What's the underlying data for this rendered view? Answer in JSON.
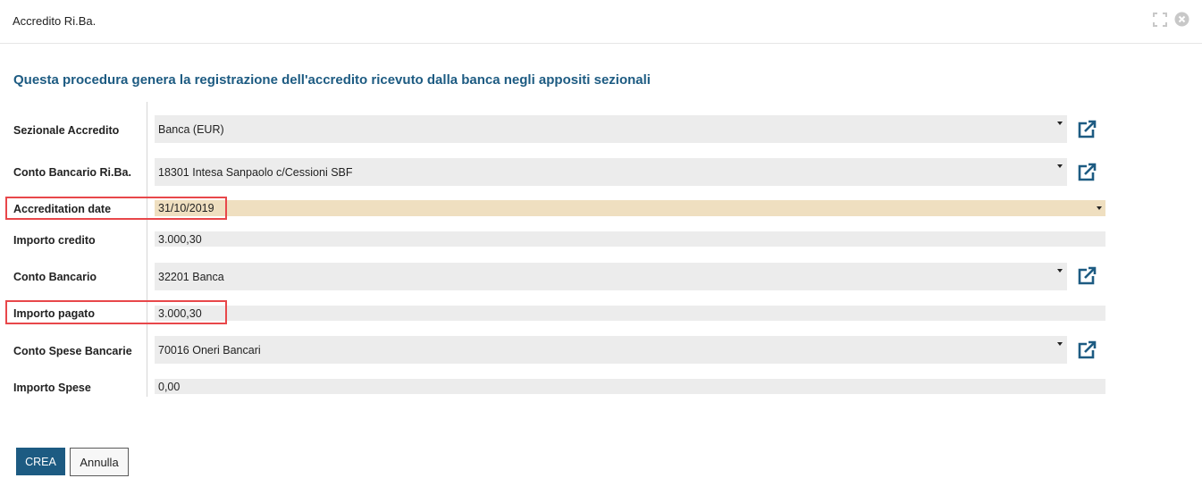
{
  "window": {
    "title": "Accredito Ri.Ba.",
    "icons": [
      "expand-icon",
      "close-icon"
    ]
  },
  "heading": "Questa procedura genera la registrazione dell'accredito ricevuto dalla banca negli appositi sezionali",
  "fields": {
    "sezionale_accredito": {
      "label": "Sezionale Accredito",
      "value": "Banca (EUR)"
    },
    "conto_bancario_riba": {
      "label": "Conto Bancario Ri.Ba.",
      "value": "18301 Intesa Sanpaolo c/Cessioni SBF"
    },
    "accreditation_date": {
      "label": "Accreditation date",
      "value": "31/10/2019"
    },
    "importo_credito": {
      "label": "Importo credito",
      "value": "3.000,30"
    },
    "conto_bancario": {
      "label": "Conto Bancario",
      "value": "32201 Banca"
    },
    "importo_pagato": {
      "label": "Importo pagato",
      "value": "3.000,30"
    },
    "conto_spese_bancarie": {
      "label": "Conto Spese Bancarie",
      "value": "70016 Oneri Bancari"
    },
    "importo_spese": {
      "label": "Importo Spese",
      "value": "0,00"
    }
  },
  "buttons": {
    "create": "CREA",
    "cancel": "Annulla"
  },
  "colors": {
    "accent": "#1d5b82",
    "field_bg": "#ececec",
    "date_field_bg": "#efdfc0",
    "highlight_border": "#e8474a"
  }
}
